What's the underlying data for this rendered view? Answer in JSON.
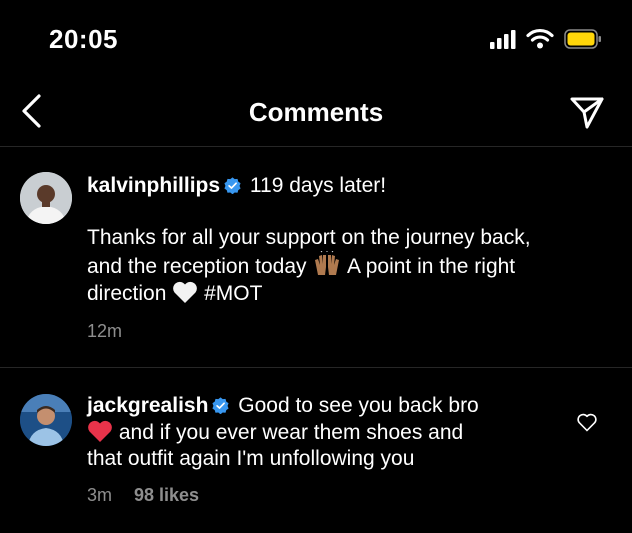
{
  "status_bar": {
    "time": "20:05"
  },
  "header": {
    "title": "Comments"
  },
  "caption": {
    "username": "kalvinphillips",
    "headline": "119 days later!",
    "body_part1": "Thanks for all your support on the journey back,",
    "body_part2": "and the reception today",
    "body_part3": "A point in the right",
    "body_part4": "direction",
    "hashtag": "#MOT",
    "time": "12m"
  },
  "comments": [
    {
      "username": "jackgrealish",
      "text_part1": "Good to see you back bro",
      "text_part2": "and if you ever wear them shoes and",
      "text_part3": "that outfit again I'm unfollowing you",
      "time": "3m",
      "likes": "98 likes"
    }
  ],
  "colors": {
    "verified": "#3897f0",
    "secondary_text": "#8e8e8e",
    "divider": "#262626",
    "battery": "#ffd60a",
    "heart_red": "#e8334a"
  }
}
